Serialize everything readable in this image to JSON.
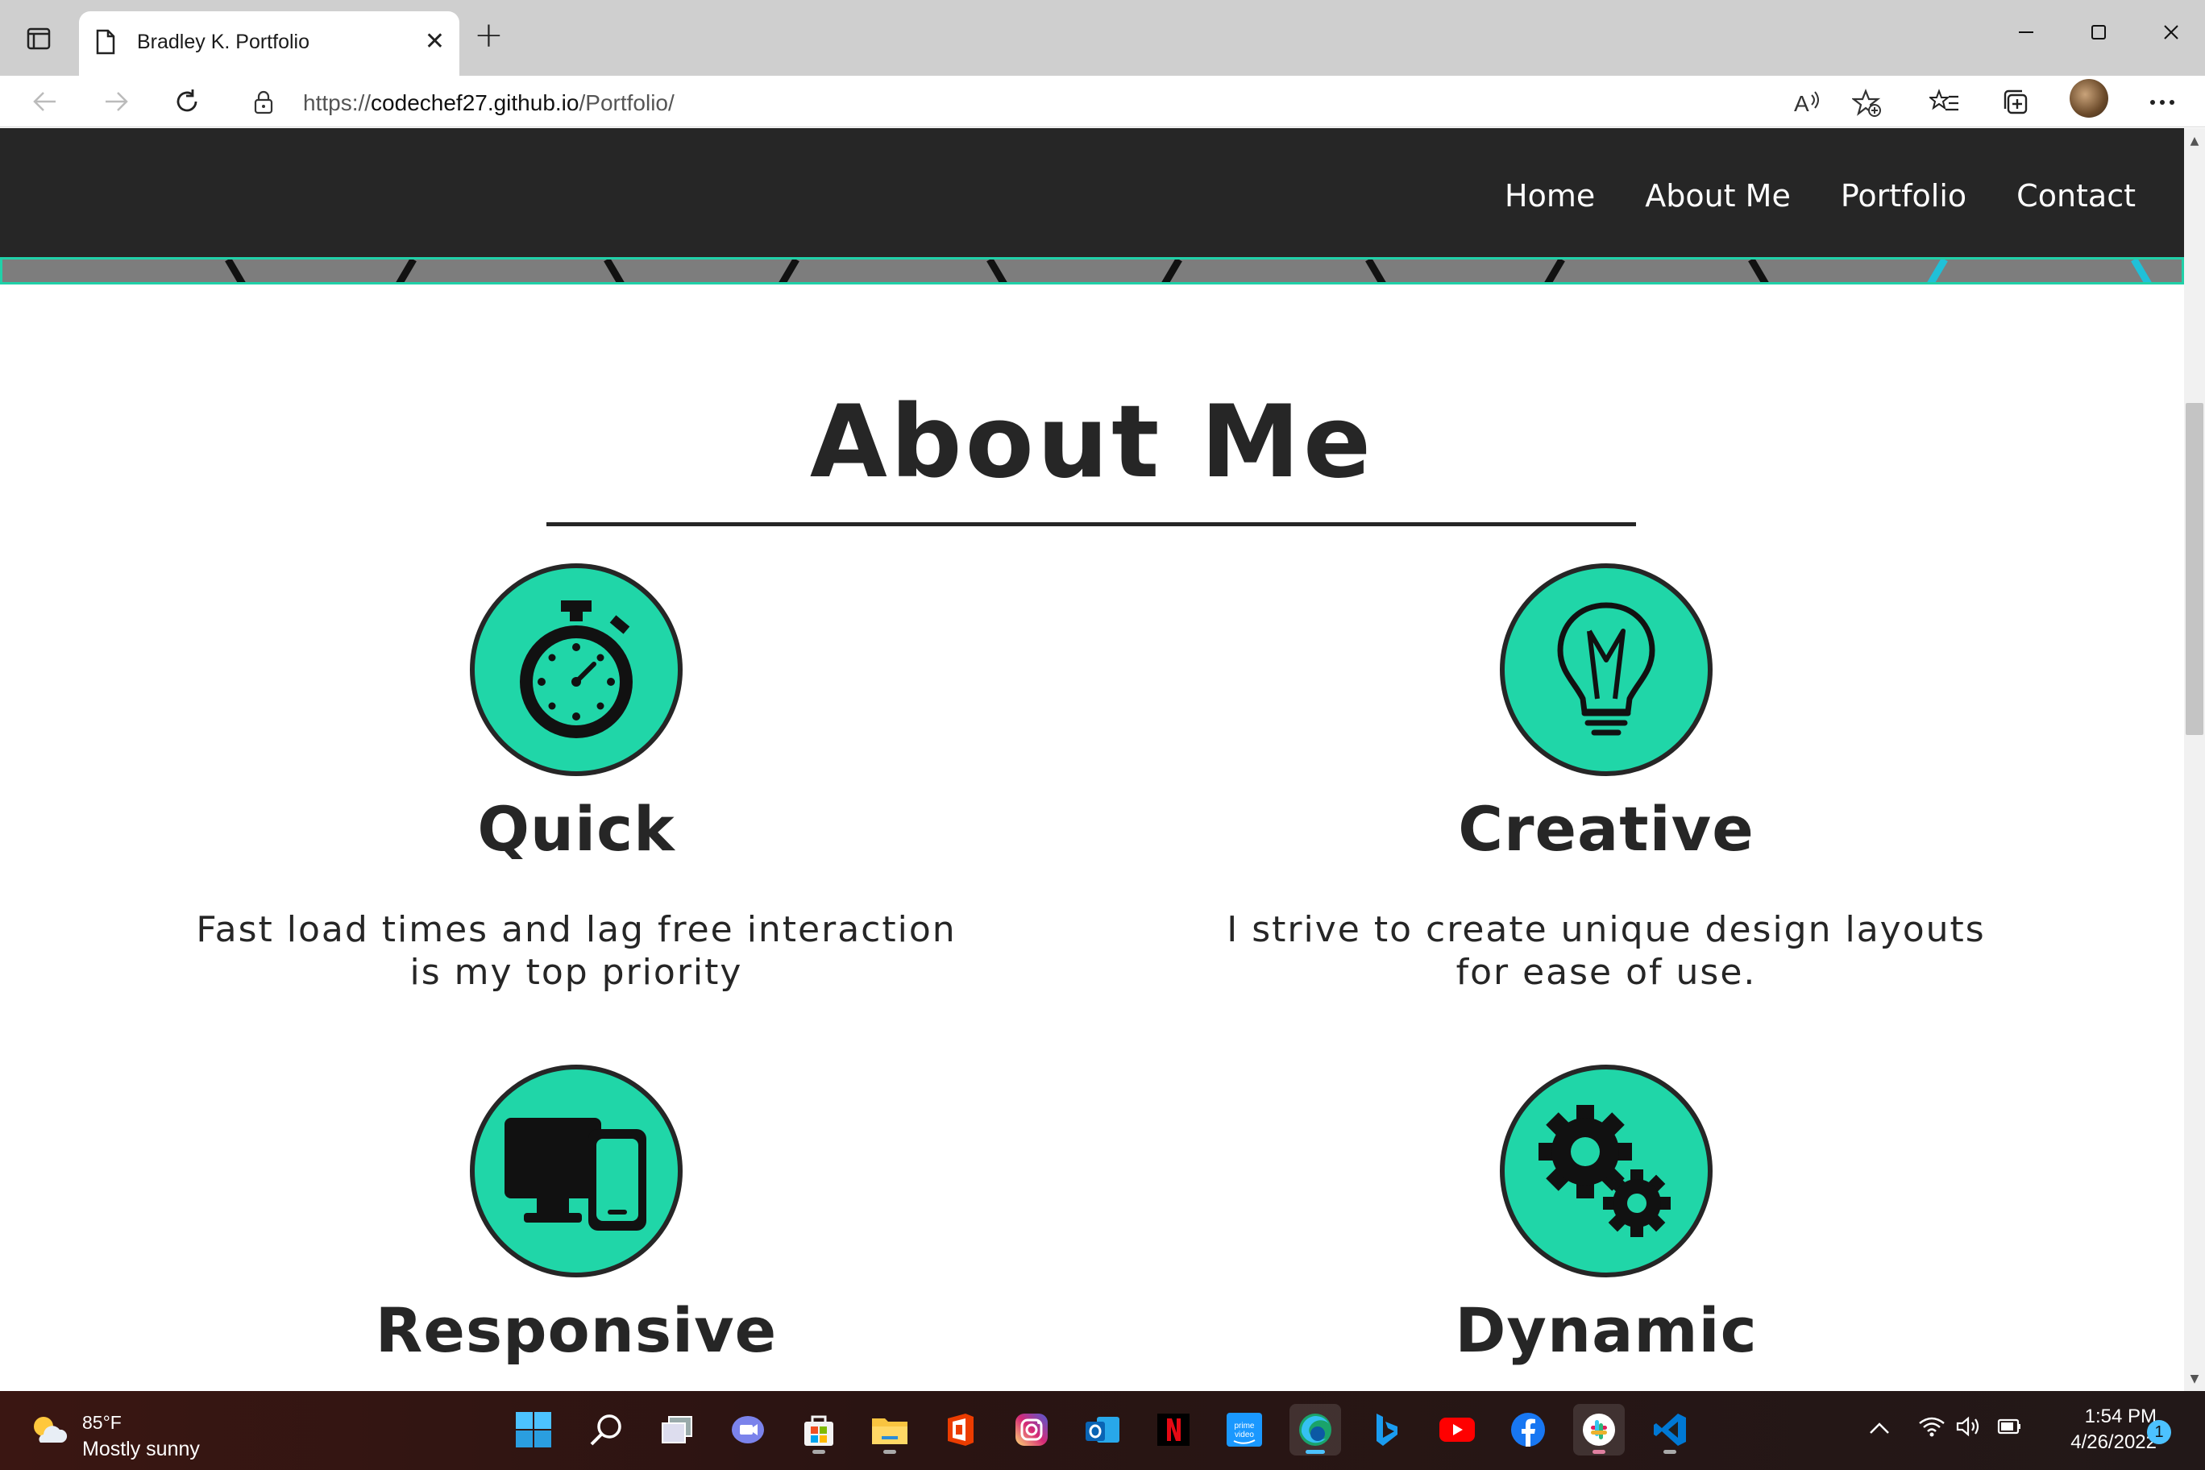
{
  "browser": {
    "tab_title": "Bradley K. Portfolio",
    "url_prefix": "https://",
    "url_host": "codechef27.github.io",
    "url_path": "/Portfolio/"
  },
  "site": {
    "nav": [
      "Home",
      "About Me",
      "Portfolio",
      "Contact"
    ],
    "accent_color": "#20d6a8",
    "dark_color": "#262626",
    "section_title": "About Me",
    "features": [
      {
        "title": "Quick",
        "text_line1": "Fast load times and lag free interaction",
        "text_line2": "is my top priority",
        "icon": "stopwatch-icon"
      },
      {
        "title": "Creative",
        "text_line1": "I strive to create unique design layouts",
        "text_line2": "for ease of use.",
        "icon": "lightbulb-icon"
      },
      {
        "title": "Responsive",
        "icon": "devices-icon"
      },
      {
        "title": "Dynamic",
        "icon": "gears-icon"
      }
    ]
  },
  "taskbar": {
    "weather_temp": "85°F",
    "weather_desc": "Mostly sunny",
    "time": "1:54 PM",
    "date": "4/26/2022",
    "notification_count": "1"
  }
}
